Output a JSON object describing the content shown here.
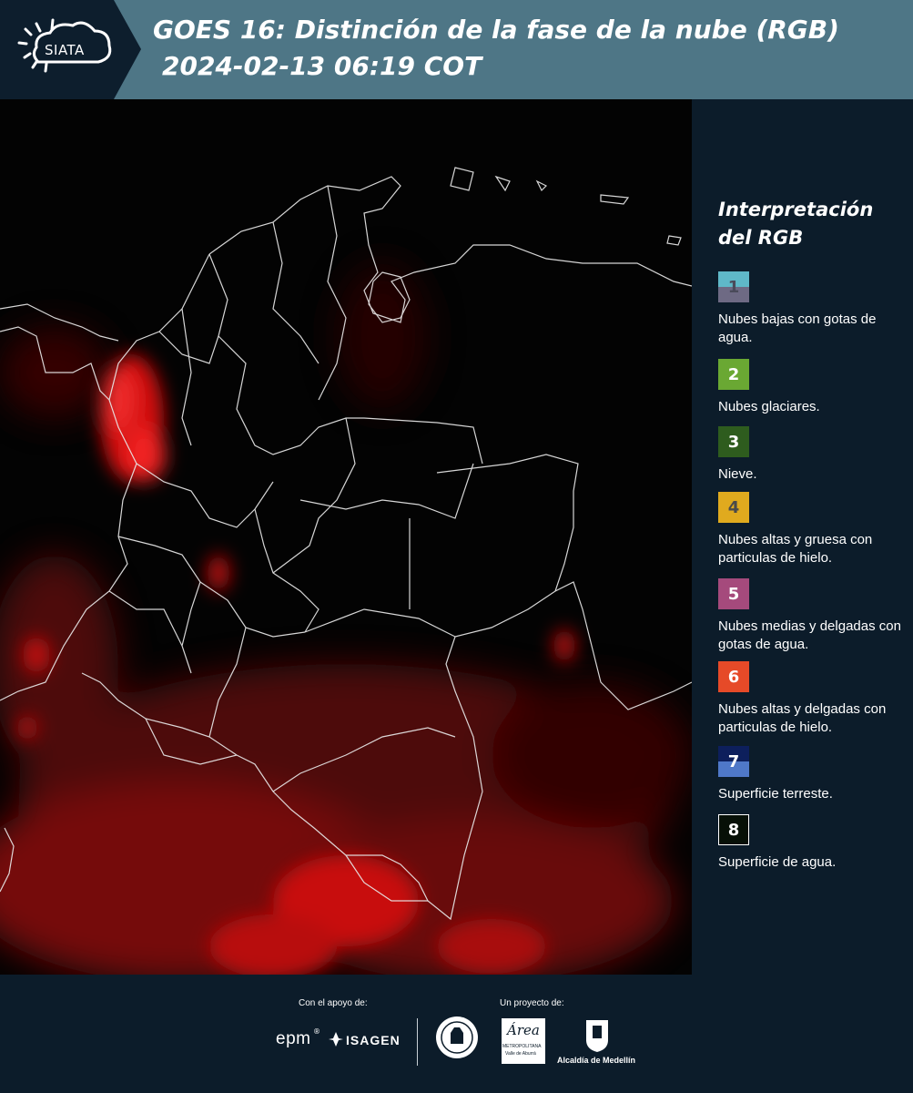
{
  "header": {
    "logo_text": "SIATA",
    "title": "GOES 16: Distinción de la fase de la nube (RGB)",
    "subtitle": "2024-02-13 06:19 COT"
  },
  "legend": {
    "title_line1": "Interpretación",
    "title_line2": "del RGB",
    "items": [
      {
        "number": "1",
        "label": "Nubes bajas con gotas de agua.",
        "color_top": "#5fb8c8",
        "color_bottom": "#6e6a84",
        "num_color": "#4a4a5a"
      },
      {
        "number": "2",
        "label": "Nubes glaciares.",
        "color_top": "#6aa833",
        "color_bottom": "#6aa833",
        "num_color": "#ffffff"
      },
      {
        "number": "3",
        "label": "Nieve.",
        "color_top": "#2e5c1e",
        "color_bottom": "#2e5c1e",
        "num_color": "#ffffff"
      },
      {
        "number": "4",
        "label": "Nubes altas y gruesa con particulas de hielo.",
        "color_top": "#e0aa1e",
        "color_bottom": "#e0aa1e",
        "num_color": "#4a4a4a"
      },
      {
        "number": "5",
        "label": "Nubes medias y delgadas con gotas de agua.",
        "color_top": "#a54a7c",
        "color_bottom": "#a54a7c",
        "num_color": "#ffffff"
      },
      {
        "number": "6",
        "label": "Nubes altas y delgadas con particulas de hielo.",
        "color_top": "#e64a28",
        "color_bottom": "#e64a28",
        "num_color": "#ffffff"
      },
      {
        "number": "7",
        "label": "Superficie terreste.",
        "color_top": "#0d1f5c",
        "color_bottom": "#4f78c8",
        "num_color": "#ffffff"
      },
      {
        "number": "8",
        "label": "Superficie de agua.",
        "color_top": "#071007",
        "color_bottom": "#071007",
        "num_color": "#ffffff"
      }
    ]
  },
  "footer": {
    "support_label": "Con el apoyo de:",
    "project_label": "Un proyecto de:",
    "sponsor_epm": "epm",
    "sponsor_isagen": "ISAGEN",
    "area_name": "Área",
    "area_sub1": "METROPOLITANA",
    "area_sub2": "Valle de Aburrá",
    "alcaldia": "Alcaldía de Medellín"
  }
}
